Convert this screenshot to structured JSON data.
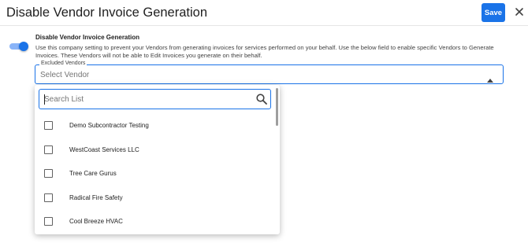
{
  "header": {
    "title": "Disable Vendor Invoice Generation",
    "save_label": "Save"
  },
  "setting": {
    "enabled": true,
    "title": "Disable Vendor Invoice Generation",
    "description": "Use this company setting to prevent your Vendors from generating invoices for services performed on your behalf. Use the below field to enable specific Vendors to Generate Invoices. These Vendors will not be able to Edit Invoices you generate on their behalf."
  },
  "excluded_vendors": {
    "label": "Excluded Vendors",
    "placeholder": "Select Vendor",
    "search_placeholder": "Search List",
    "options": [
      {
        "label": "Demo Subcontractor Testing",
        "checked": false
      },
      {
        "label": "WestCoast Services LLC",
        "checked": false
      },
      {
        "label": "Tree Care Gurus",
        "checked": false
      },
      {
        "label": "Radical Fire Safety",
        "checked": false
      },
      {
        "label": "Cool Breeze HVAC",
        "checked": false
      }
    ]
  },
  "colors": {
    "accent": "#1a73e8",
    "toggle_track": "#8ab4f8"
  },
  "icons": {
    "close": "close-icon",
    "dropdown": "arrow-up-icon",
    "search": "search-icon"
  }
}
